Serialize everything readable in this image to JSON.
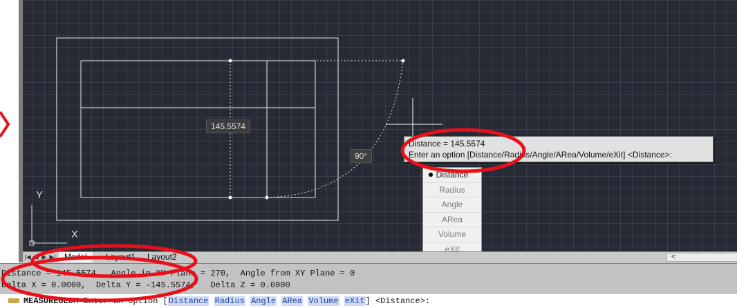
{
  "canvas": {
    "dim_label": "145.5574",
    "angle_label": "90°",
    "ucs": {
      "y_label": "Y",
      "x_label": "X"
    }
  },
  "prompt_tooltip": {
    "line1": "Distance = 145.5574",
    "line2": "Enter an option [Distance/Radius/Angle/ARea/Volume/eXit] <Distance>:"
  },
  "dynamic_menu": {
    "items": [
      "Distance",
      "Radius",
      "Angle",
      "ARea",
      "Volume",
      "eXit"
    ],
    "selected": "Distance"
  },
  "tabs": {
    "items": [
      "Model",
      "Layout1",
      "Layout2"
    ],
    "active": "Model",
    "scroll_arrow": "<"
  },
  "history": {
    "line1": "Distance = 145.5574,  Angle in XY Plane = 270,  Angle from XY Plane = 0",
    "line2": "Delta X = 0.0000,  Delta Y = -145.5574,   Delta Z = 0.0000"
  },
  "command_line": {
    "command": "MEASUREGEOM",
    "text": " Enter an option [",
    "options": [
      "Distance",
      "Radius",
      "Angle",
      "ARea",
      "Volume",
      "eXit"
    ],
    "suffix": "] <Distance>:"
  },
  "colors": {
    "canvas_bg": "#252a34",
    "annotation_red": "#e8101a",
    "tab_bar": "#c9c9c9",
    "history_bg": "#c3c3c3"
  }
}
